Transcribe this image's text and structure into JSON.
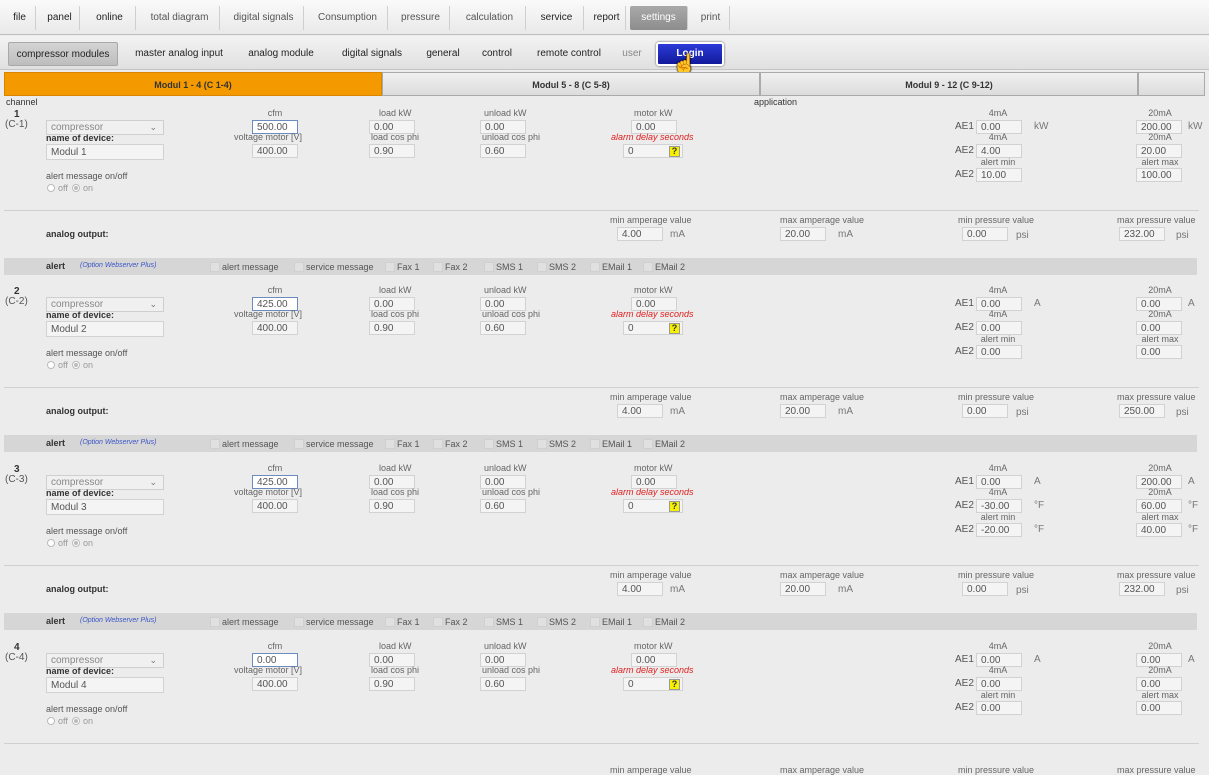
{
  "nav_main": [
    {
      "label": "file"
    },
    {
      "label": "panel"
    },
    {
      "label": "online"
    },
    {
      "label": "total diagram"
    },
    {
      "label": "digital signals"
    },
    {
      "label": "Consumption"
    },
    {
      "label": "pressure"
    },
    {
      "label": "calculation"
    },
    {
      "label": "service"
    },
    {
      "label": "report"
    },
    {
      "label": "settings"
    },
    {
      "label": "print"
    }
  ],
  "nav_sub": [
    {
      "label": "compressor modules"
    },
    {
      "label": "master analog input"
    },
    {
      "label": "analog module"
    },
    {
      "label": "digital signals"
    },
    {
      "label": "general"
    },
    {
      "label": "control"
    },
    {
      "label": "remote control"
    },
    {
      "label": "user"
    },
    {
      "label": "Login"
    }
  ],
  "tabs": [
    {
      "label": "Modul 1 - 4 (C 1-4)"
    },
    {
      "label": "Modul 5 - 8 (C 5-8)"
    },
    {
      "label": "Modul 9 - 12 (C 9-12)"
    }
  ],
  "headers": {
    "channel": "channel",
    "application": "application"
  },
  "labels": {
    "cfm": "cfm",
    "load_kw": "load kW",
    "unload_kw": "unload kW",
    "motor_kw": "motor kW",
    "voltage": "voltage motor [V]",
    "load_cos": "load cos phi",
    "unload_cos": "unload cos phi",
    "alarm_delay": "alarm delay seconds",
    "name_of_device": "name of device:",
    "alert_onoff": "alert message on/off",
    "off": "off",
    "on": "on",
    "ma4": "4mA",
    "ma20": "20mA",
    "alert_min": "alert min",
    "alert_max": "alert max",
    "ae1": "AE1",
    "ae2": "AE2",
    "analog_output": "analog output:",
    "min_amp": "min amperage value",
    "max_amp": "max amperage value",
    "min_press": "min pressure value",
    "max_press": "max pressure value",
    "unit_ma": "mA",
    "unit_psi": "psi",
    "alert": "alert",
    "option": "(Option Webserver Plus)",
    "alert_opts": [
      "alert message",
      "service message",
      "Fax 1",
      "Fax 2",
      "SMS 1",
      "SMS 2",
      "EMail 1",
      "EMail 2"
    ],
    "help": "?"
  },
  "modules": [
    {
      "num": "1",
      "cnum": "(C-1)",
      "type": "compressor",
      "name": "Modul 1",
      "cfm": "500.00",
      "load_kw": "0.00",
      "unload_kw": "0.00",
      "motor_kw": "0.00",
      "voltage": "400.00",
      "load_cos": "0.90",
      "unload_cos": "0.60",
      "alarm_delay": "0",
      "ae1_4ma": "0.00",
      "ae1_unit": "kW",
      "ae1_20ma": "200.00",
      "ae1_20ma_unit": "kW",
      "ae2_4ma": "4.00",
      "ae2_unit": "",
      "ae2_20ma": "20.00",
      "ae2_20ma_unit": "",
      "alert_min": "10.00",
      "alert_min_unit": "",
      "alert_max": "100.00",
      "alert_max_unit": "",
      "min_amp": "4.00",
      "max_amp": "20.00",
      "min_press": "0.00",
      "max_press": "232.00"
    },
    {
      "num": "2",
      "cnum": "(C-2)",
      "type": "compressor",
      "name": "Modul 2",
      "cfm": "425.00",
      "load_kw": "0.00",
      "unload_kw": "0.00",
      "motor_kw": "0.00",
      "voltage": "400.00",
      "load_cos": "0.90",
      "unload_cos": "0.60",
      "alarm_delay": "0",
      "ae1_4ma": "0.00",
      "ae1_unit": "A",
      "ae1_20ma": "0.00",
      "ae1_20ma_unit": "A",
      "ae2_4ma": "0.00",
      "ae2_unit": "",
      "ae2_20ma": "0.00",
      "ae2_20ma_unit": "",
      "alert_min": "0.00",
      "alert_min_unit": "",
      "alert_max": "0.00",
      "alert_max_unit": "",
      "min_amp": "4.00",
      "max_amp": "20.00",
      "min_press": "0.00",
      "max_press": "250.00"
    },
    {
      "num": "3",
      "cnum": "(C-3)",
      "type": "compressor",
      "name": "Modul 3",
      "cfm": "425.00",
      "load_kw": "0.00",
      "unload_kw": "0.00",
      "motor_kw": "0.00",
      "voltage": "400.00",
      "load_cos": "0.90",
      "unload_cos": "0.60",
      "alarm_delay": "0",
      "ae1_4ma": "0.00",
      "ae1_unit": "A",
      "ae1_20ma": "200.00",
      "ae1_20ma_unit": "A",
      "ae2_4ma": "-30.00",
      "ae2_unit": "°F",
      "ae2_20ma": "60.00",
      "ae2_20ma_unit": "°F",
      "alert_min": "-20.00",
      "alert_min_unit": "°F",
      "alert_max": "40.00",
      "alert_max_unit": "°F",
      "min_amp": "4.00",
      "max_amp": "20.00",
      "min_press": "0.00",
      "max_press": "232.00"
    },
    {
      "num": "4",
      "cnum": "(C-4)",
      "type": "compressor",
      "name": "Modul 4",
      "cfm": "0.00",
      "load_kw": "0.00",
      "unload_kw": "0.00",
      "motor_kw": "0.00",
      "voltage": "400.00",
      "load_cos": "0.90",
      "unload_cos": "0.60",
      "alarm_delay": "0",
      "ae1_4ma": "0.00",
      "ae1_unit": "A",
      "ae1_20ma": "0.00",
      "ae1_20ma_unit": "A",
      "ae2_4ma": "0.00",
      "ae2_unit": "",
      "ae2_20ma": "0.00",
      "ae2_20ma_unit": "",
      "alert_min": "0.00",
      "alert_min_unit": "",
      "alert_max": "0.00",
      "alert_max_unit": ""
    }
  ]
}
